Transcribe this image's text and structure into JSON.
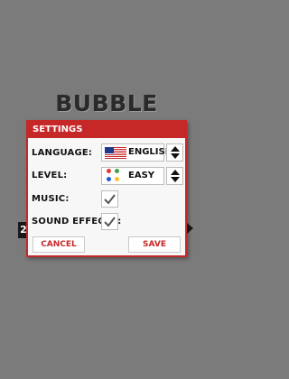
{
  "game": {
    "title": "Bubble Breaker",
    "left_tab_text": "2"
  },
  "settings": {
    "header": "Settings",
    "language": {
      "label": "Language:",
      "value": "English",
      "icon": "us-flag-icon"
    },
    "level": {
      "label": "Level:",
      "value": "Easy",
      "icon": "bubbles-icon"
    },
    "music": {
      "label": "Music:",
      "checked": true
    },
    "sound_effects": {
      "label": "Sound Effects:",
      "checked": true
    },
    "cancel_label": "Cancel",
    "save_label": "Save"
  },
  "colors": {
    "accent": "#c62828",
    "background": "#7b7b7b",
    "dialog": "#f7f7f7",
    "bubble_red": "#e53935",
    "bubble_green": "#43a047",
    "bubble_blue": "#1e5bd8",
    "bubble_yellow": "#fbc02d"
  }
}
